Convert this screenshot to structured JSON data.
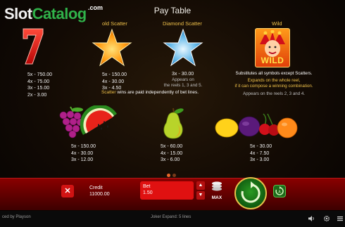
{
  "title": "Pay Table",
  "watermark": {
    "part1": "Slot",
    "part2": "Catalog",
    "suffix": ".com"
  },
  "symbols_top": [
    {
      "name": "seven",
      "header": "",
      "pays": [
        "5x - 750.00",
        "4x - 75.00",
        "3x - 15.00",
        "2x - 3.00"
      ]
    },
    {
      "name": "gold-scatter",
      "header": "old Scatter",
      "pays": [
        "5x - 150.00",
        "4x - 30.00",
        "3x - 4.50"
      ]
    },
    {
      "name": "diamond-scatter",
      "header": "Diamond Scatter",
      "pays": [
        "3x - 30.00"
      ],
      "appears": [
        "Appears on",
        "the reels 1, 3 and 5."
      ]
    },
    {
      "name": "wild",
      "header": "Wild",
      "badge": "WILD",
      "lines": [
        "Substitutes all symbols except Scatters."
      ],
      "expands": [
        "Expands on the whole reel,",
        "if it can compose a winning combination."
      ],
      "appears": "Appears on the reels 2, 3 and 4."
    }
  ],
  "scatter_note": {
    "word": "Scatter",
    "rest": " wins are paid independently of bet lines."
  },
  "symbols_bottom": [
    {
      "name": "grapes-watermelon",
      "pays": [
        "5x - 150.00",
        "4x - 30.00",
        "3x - 12.00"
      ]
    },
    {
      "name": "pear",
      "pays": [
        "5x - 60.00",
        "4x - 15.00",
        "3x - 6.00"
      ]
    },
    {
      "name": "lemon-plum-cherry-orange",
      "pays": [
        "5x - 30.00",
        "4x - 7.50",
        "3x - 3.00"
      ]
    }
  ],
  "pagination": {
    "active": 0,
    "count": 2,
    "active_color": "#e8672a",
    "inactive_color": "#7a3a1a"
  },
  "panel": {
    "close_label": "✕",
    "credit_label": "Credit",
    "credit_value": "11000.00",
    "bet_label": "Bet",
    "bet_value": "1.50",
    "max_label": "MAX"
  },
  "footer": {
    "provider": "ced by Playson",
    "joker": "Joker Expand: 5 lines"
  },
  "colors": {
    "accent": "#f0c24a",
    "panel": "#7a0000",
    "spin": "#1e7a1a"
  }
}
